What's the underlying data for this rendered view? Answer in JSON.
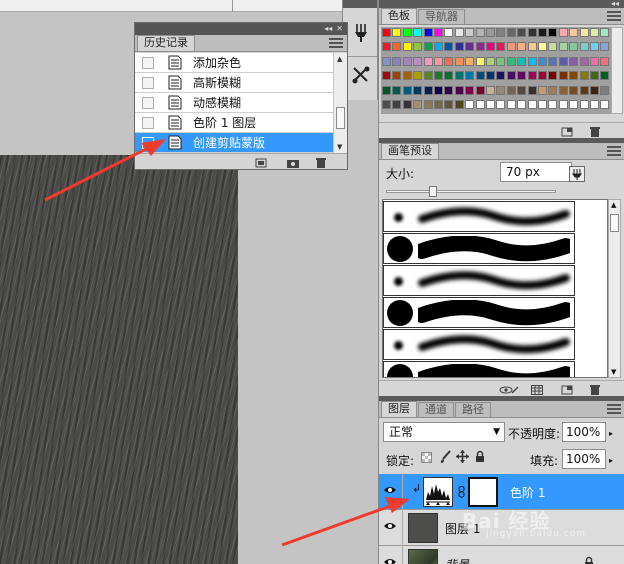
{
  "history_panel": {
    "tab_label": "历史记录",
    "items": [
      {
        "label": "添加杂色",
        "selected": false
      },
      {
        "label": "高斯模糊",
        "selected": false
      },
      {
        "label": "动感模糊",
        "selected": false
      },
      {
        "label": "色阶 1 图层",
        "selected": false
      },
      {
        "label": "创建剪贴蒙版",
        "selected": true
      }
    ]
  },
  "swatches_panel": {
    "tabs": [
      "色板",
      "导航器"
    ],
    "colors": [
      [
        "#ff0000",
        "#ffff00",
        "#00ff00",
        "#00ffff",
        "#0000ff",
        "#ff00ff",
        "#ffffff",
        "#e6e6e6",
        "#cccccc",
        "#b3b3b3",
        "#999999",
        "#808080",
        "#666666",
        "#4d4d4d",
        "#333333",
        "#1a1a1a",
        "#000000",
        "#f7a8a8",
        "#f7c8a0",
        "#f7e8a0",
        "#d8f0a0",
        "#a0e8c0"
      ],
      [
        "#ed1c24",
        "#f26522",
        "#fff200",
        "#8dc63f",
        "#00a651",
        "#00aeef",
        "#0054a6",
        "#2e3192",
        "#662d91",
        "#92278f",
        "#ec008c",
        "#ed145b",
        "#f7977a",
        "#f9ad81",
        "#fdc68a",
        "#fff79a",
        "#c4df9b",
        "#a3d39c",
        "#82ca9d",
        "#7bcdc8",
        "#6ecff6",
        "#7ea7d8"
      ],
      [
        "#8393ca",
        "#8781bd",
        "#a187be",
        "#bc8dbf",
        "#f49ac2",
        "#f6989d",
        "#f26c4f",
        "#f68e55",
        "#fbaf5d",
        "#fff568",
        "#acd372",
        "#7cc576",
        "#3bb878",
        "#1abbb4",
        "#00bff3",
        "#438ccb",
        "#5574b9",
        "#605ca8",
        "#855fa8",
        "#a763a8",
        "#f06ea9",
        "#f26d7d"
      ],
      [
        "#9e0b0f",
        "#a0410d",
        "#a36209",
        "#aba000",
        "#598527",
        "#197b30",
        "#007236",
        "#00746b",
        "#0076a3",
        "#004b80",
        "#003471",
        "#1b1464",
        "#440e62",
        "#630460",
        "#9e005d",
        "#9e0039",
        "#790000",
        "#7b2e00",
        "#7d4900",
        "#827b00",
        "#406618",
        "#005e20"
      ],
      [
        "#005826",
        "#005952",
        "#005b7f",
        "#003663",
        "#002157",
        "#0d004c",
        "#32004b",
        "#4b0049",
        "#7b0046",
        "#7a0026",
        "#c7b299",
        "#998675",
        "#736357",
        "#534741",
        "#37302d",
        "#c69c6d",
        "#a67c52",
        "#8c6239",
        "#754c24",
        "#603913",
        "#3c2415",
        "#7d7d7d"
      ],
      [
        "#4d4d4d",
        "#404040",
        "#333333",
        "#a08f6a",
        "#8a7a58",
        "#766846",
        "#625634",
        "#4e4422",
        "#ffffff",
        "#ffffff",
        "#ffffff",
        "#ffffff",
        "#ffffff",
        "#ffffff",
        "#ffffff",
        "#ffffff",
        "#ffffff",
        "#ffffff",
        "#ffffff",
        "#ffffff",
        "#ffffff",
        "#ffffff"
      ]
    ]
  },
  "brush_panel": {
    "tab_label": "画笔预设",
    "size_label": "大小:",
    "size_value": "70 px",
    "size_fraction": 0.27
  },
  "layers_panel": {
    "tabs": [
      "图层",
      "通道",
      "路径"
    ],
    "blend_mode": "正常",
    "opacity_label": "不透明度:",
    "opacity_value": "100%",
    "lock_label": "锁定:",
    "fill_label": "填充:",
    "fill_value": "100%",
    "layers": [
      {
        "name": "色阶 1",
        "selected": true
      },
      {
        "name": "图层 1",
        "selected": false
      },
      {
        "name": "背景",
        "selected": false
      }
    ]
  },
  "watermark": {
    "text": "Bai 经验",
    "sub": "jingyan.baidu.com"
  }
}
